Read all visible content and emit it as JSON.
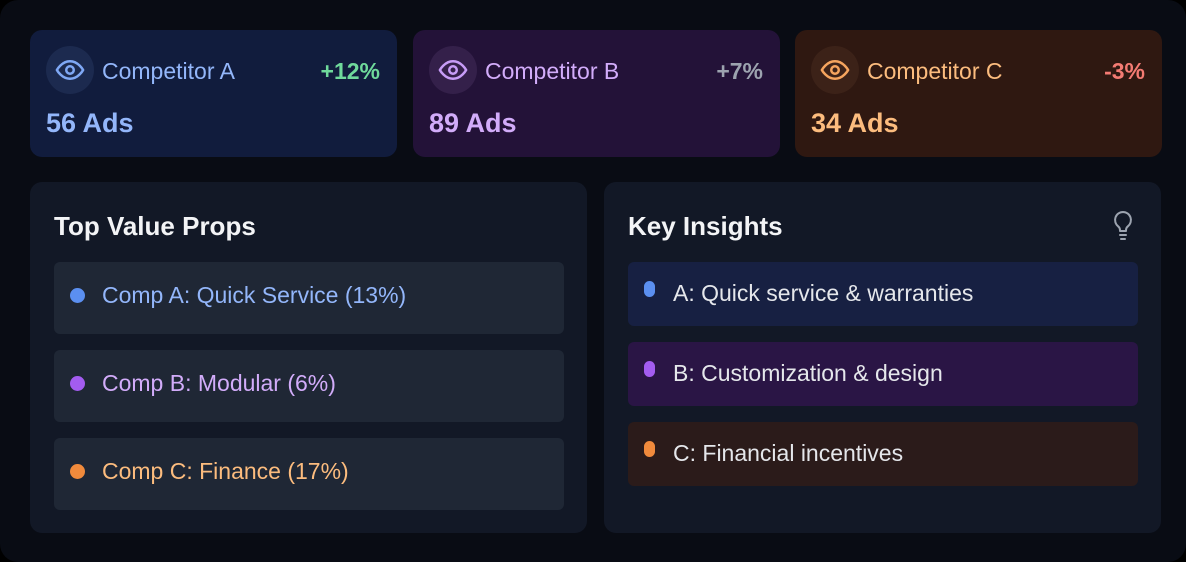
{
  "competitors": [
    {
      "name": "Competitor A",
      "change": "+12%",
      "count": "56 Ads",
      "icon": "eye-icon"
    },
    {
      "name": "Competitor B",
      "change": "+7%",
      "count": "89 Ads",
      "icon": "eye-icon"
    },
    {
      "name": "Competitor C",
      "change": "-3%",
      "count": "34 Ads",
      "icon": "eye-icon"
    }
  ],
  "value_props": {
    "title": "Top Value Props",
    "items": [
      {
        "text": "Comp A: Quick Service (13%)",
        "color": "#5b8ff0"
      },
      {
        "text": "Comp B: Modular (6%)",
        "color": "#a35cf0"
      },
      {
        "text": "Comp C: Finance (17%)",
        "color": "#f08a3c"
      }
    ]
  },
  "insights": {
    "title": "Key Insights",
    "icon": "lightbulb-icon",
    "items": [
      {
        "text": "A: Quick service & warranties",
        "color": "#5b8ff0"
      },
      {
        "text": "B: Customization & design",
        "color": "#a35cf0"
      },
      {
        "text": "C: Financial incentives",
        "color": "#f08a3c"
      }
    ]
  },
  "colors": {
    "accent_a": "#93b6fa",
    "accent_b": "#d2acfa",
    "accent_c": "#fcbc7e",
    "positive": "#6fd99b",
    "neutral": "#9ca3af",
    "negative": "#f47b73"
  }
}
